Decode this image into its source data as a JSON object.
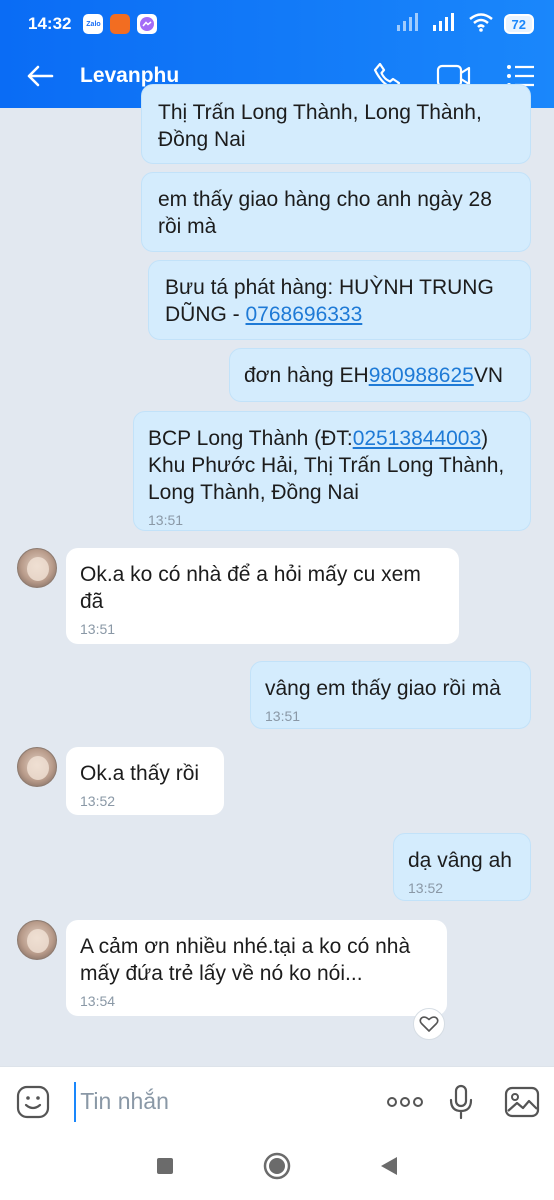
{
  "status_bar": {
    "time": "14:32",
    "app_icons": [
      {
        "name": "zalo-icon",
        "label": "Zalo",
        "color": "#1a6ff5"
      },
      {
        "name": "shopee-icon",
        "label": "",
        "color": "#f26d21"
      },
      {
        "name": "messenger-icon",
        "label": "",
        "color": "#a36cf7"
      }
    ],
    "battery": "72"
  },
  "header": {
    "title": "Levanphu"
  },
  "messages": [
    {
      "id": "m1",
      "direction": "out",
      "text": "Thị Trấn Long Thành, Long Thành,\nĐồng Nai",
      "time": ""
    },
    {
      "id": "m2",
      "direction": "out",
      "text": "em thấy giao hàng cho anh ngày 28\nrồi mà",
      "time": ""
    },
    {
      "id": "m3",
      "direction": "out",
      "text_before": "Bưu tá phát hàng:   HUỲNH TRUNG\nDŨNG - ",
      "link": "0768696333",
      "text_after": "",
      "time": ""
    },
    {
      "id": "m4",
      "direction": "out",
      "text_before": "đơn hàng EH",
      "link": "980988625",
      "text_after": "VN",
      "time": ""
    },
    {
      "id": "m5",
      "direction": "out",
      "text_before": "BCP Long Thành (ĐT:",
      "link": "02513844003",
      "text_after": ")\nKhu Phước Hải, Thị Trấn Long Thành,\nLong Thành, Đồng Nai",
      "time": "13:51"
    },
    {
      "id": "m6",
      "direction": "in",
      "text": "Ok.a ko có nhà để a hỏi mấy cu xem\nđã",
      "time": "13:51"
    },
    {
      "id": "m7",
      "direction": "out",
      "text": "vâng em thấy giao rồi mà",
      "time": "13:51"
    },
    {
      "id": "m8",
      "direction": "in",
      "text": "Ok.a thấy rồi",
      "time": "13:52"
    },
    {
      "id": "m9",
      "direction": "out",
      "text": "dạ vâng ah",
      "time": "13:52"
    },
    {
      "id": "m10",
      "direction": "in",
      "text": "A cảm ơn nhiều nhé.tại a ko có nhà\nmấy đứa trẻ lấy về nó ko nói...",
      "time": "13:54"
    }
  ],
  "composer": {
    "placeholder": "Tin nhắn"
  },
  "colors": {
    "header_gradient_start": "#0a6cf5",
    "header_gradient_end": "#1a87fb",
    "outgoing_bubble": "#d4ecfd",
    "incoming_bubble": "#ffffff",
    "chat_background": "#e2e8f0",
    "link": "#1e7ad6"
  }
}
